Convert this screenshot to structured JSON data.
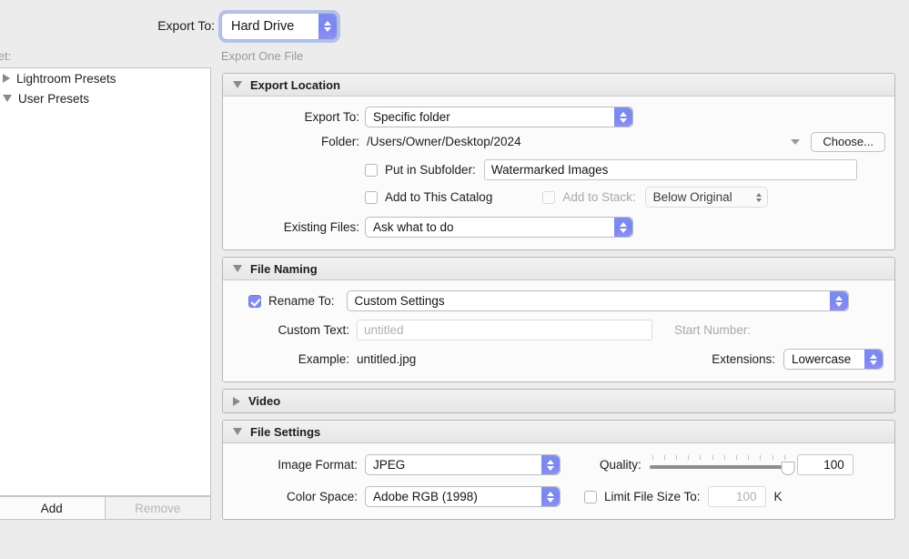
{
  "topbar": {
    "export_to_label": "Export To:",
    "export_to_value": "Hard Drive",
    "subtitle": "Export One File",
    "preset_label_clipped": "eset:"
  },
  "sidebar": {
    "items": [
      {
        "label": "Lightroom Presets",
        "expanded": false
      },
      {
        "label": "User Presets",
        "expanded": true
      }
    ],
    "add_label": "Add",
    "remove_label": "Remove"
  },
  "panels": {
    "export_location": {
      "title": "Export Location",
      "export_to_label": "Export To:",
      "export_to_value": "Specific folder",
      "folder_label": "Folder:",
      "folder_value": "/Users/Owner/Desktop/2024",
      "choose_label": "Choose...",
      "put_in_subfolder_label": "Put in Subfolder:",
      "subfolder_value": "Watermarked Images",
      "add_to_catalog_label": "Add to This Catalog",
      "add_to_stack_label": "Add to Stack:",
      "add_to_stack_value": "Below Original",
      "existing_files_label": "Existing Files:",
      "existing_files_value": "Ask what to do"
    },
    "file_naming": {
      "title": "File Naming",
      "rename_to_label": "Rename To:",
      "rename_to_value": "Custom Settings",
      "custom_text_label": "Custom Text:",
      "custom_text_placeholder": "untitled",
      "start_number_label": "Start Number:",
      "example_label": "Example:",
      "example_value": "untitled.jpg",
      "extensions_label": "Extensions:",
      "extensions_value": "Lowercase"
    },
    "video": {
      "title": "Video"
    },
    "file_settings": {
      "title": "File Settings",
      "image_format_label": "Image Format:",
      "image_format_value": "JPEG",
      "quality_label": "Quality:",
      "quality_value": "100",
      "quality_percent": 100,
      "color_space_label": "Color Space:",
      "color_space_value": "Adobe RGB (1998)",
      "limit_file_size_label": "Limit File Size To:",
      "limit_file_size_value": "100",
      "limit_file_size_unit": "K"
    }
  },
  "colors": {
    "accent": "#7e8ef0",
    "focus_ring": "#82a0eb",
    "window_bg": "#ececec",
    "panel_bg": "#fbfbfb"
  }
}
